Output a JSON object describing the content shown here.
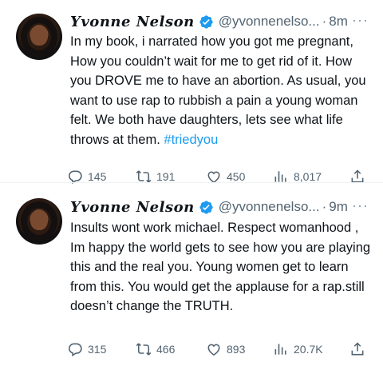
{
  "tweets": [
    {
      "author_name": "Yvonne Nelson",
      "handle": "@yvonnenelso...",
      "separator": "·",
      "time": "8m",
      "more": "···",
      "text": "In my book, i narrated how you got me pregnant, How you couldn’t wait for me to get rid of it. How you DROVE me to have an abortion. As usual, you want to use rap to rubbish a pain a young woman felt. We both have daughters, lets see what life throws at them. ",
      "hashtag": "#triedyou",
      "replies": "145",
      "retweets": "191",
      "likes": "450",
      "views": "8,017"
    },
    {
      "author_name": "Yvonne Nelson",
      "handle": "@yvonnenelso...",
      "separator": "·",
      "time": "9m",
      "more": "···",
      "text": "Insults wont work michael. Respect womanhood , Im happy the world gets to see how you are playing this and the real you. Young women get to learn from this. You would get the applause for a rap.still doesn’t change the TRUTH.",
      "replies": "315",
      "retweets": "466",
      "likes": "893",
      "views": "20.7K"
    }
  ],
  "colors": {
    "accent": "#1d9bf0",
    "muted": "#536471",
    "text": "#0f1419"
  },
  "icons": [
    "reply-icon",
    "retweet-icon",
    "like-icon",
    "views-icon",
    "share-icon",
    "verified-badge-icon"
  ]
}
